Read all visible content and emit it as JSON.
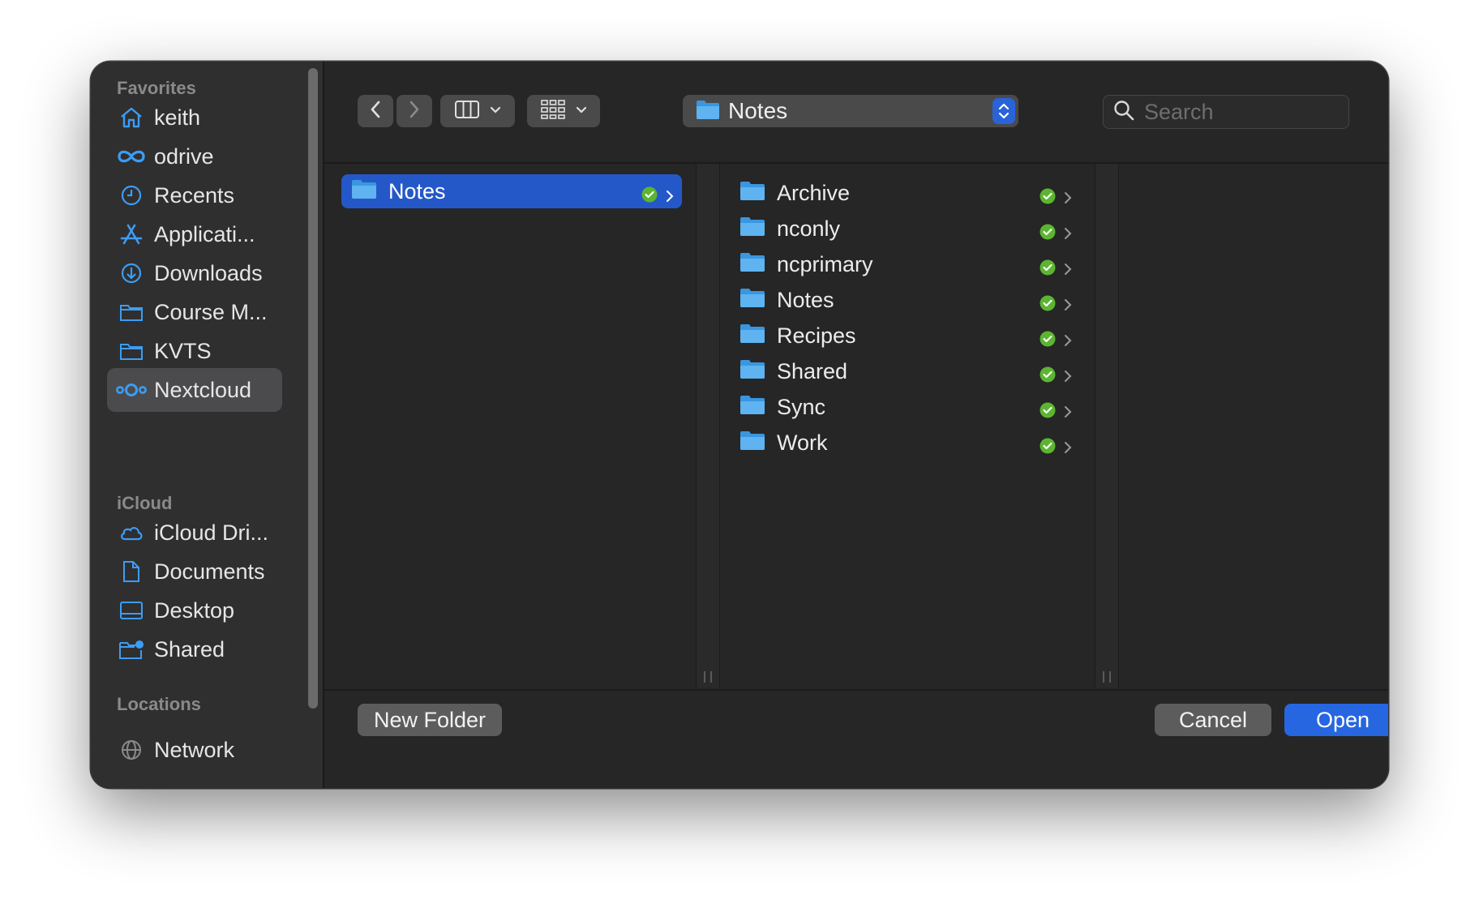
{
  "sidebar": {
    "sections": [
      "Favorites",
      "iCloud",
      "Locations"
    ],
    "favorites": [
      {
        "label": "keith",
        "icon": "home-icon"
      },
      {
        "label": "odrive",
        "icon": "infinity-icon"
      },
      {
        "label": "Recents",
        "icon": "clock-icon"
      },
      {
        "label": "Applicati...",
        "icon": "applications-icon"
      },
      {
        "label": "Downloads",
        "icon": "download-icon"
      },
      {
        "label": "Course M...",
        "icon": "folder-icon"
      },
      {
        "label": "KVTS",
        "icon": "folder-icon"
      },
      {
        "label": "Nextcloud",
        "icon": "nextcloud-icon",
        "selected": true
      }
    ],
    "icloud": [
      {
        "label": "iCloud Dri...",
        "icon": "cloud-icon"
      },
      {
        "label": "Documents",
        "icon": "document-icon"
      },
      {
        "label": "Desktop",
        "icon": "desktop-icon"
      },
      {
        "label": "Shared",
        "icon": "shared-folder-icon"
      }
    ],
    "locations": [
      {
        "label": "Network",
        "icon": "network-icon"
      }
    ]
  },
  "toolbar": {
    "path_label": "Notes",
    "search_placeholder": "Search"
  },
  "columns": {
    "first": [
      {
        "label": "Notes",
        "selected": true,
        "synced": true
      }
    ],
    "second": [
      {
        "label": "Archive",
        "synced": true
      },
      {
        "label": "nconly",
        "synced": true
      },
      {
        "label": "ncprimary",
        "synced": true
      },
      {
        "label": "Notes",
        "synced": true
      },
      {
        "label": "Recipes",
        "synced": true
      },
      {
        "label": "Shared",
        "synced": true
      },
      {
        "label": "Sync",
        "synced": true
      },
      {
        "label": "Work",
        "synced": true
      }
    ]
  },
  "footer": {
    "new_folder_label": "New Folder",
    "cancel_label": "Cancel",
    "open_label": "Open"
  },
  "colors": {
    "accent": "#2666e0",
    "selection": "#2458c9",
    "sidebar_icon": "#3d9cf5",
    "sync_green": "#5cb531",
    "folder_blue": "#5eb3f0"
  }
}
